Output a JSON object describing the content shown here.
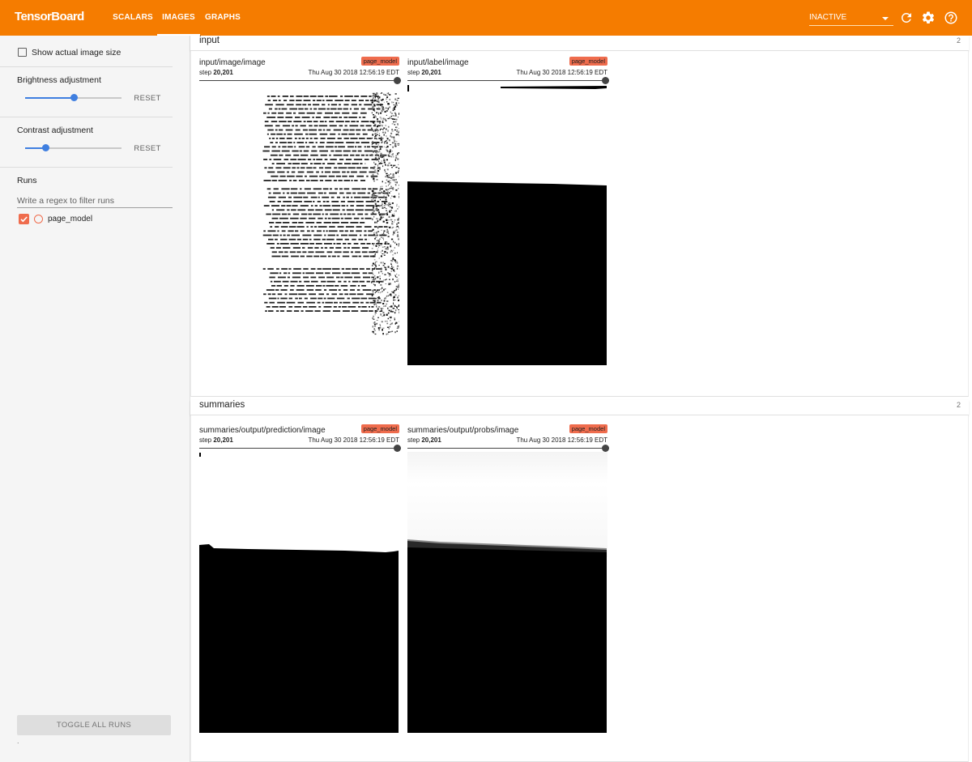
{
  "app": {
    "title": "TensorBoard",
    "tabs": [
      {
        "label": "SCALARS",
        "active": false
      },
      {
        "label": "IMAGES",
        "active": true
      },
      {
        "label": "GRAPHS",
        "active": false
      }
    ],
    "status_select": "INACTIVE",
    "icons": [
      "refresh-icon",
      "settings-icon",
      "help-icon"
    ],
    "accent_color": "#f57c00"
  },
  "sidebar": {
    "show_actual_size": {
      "label": "Show actual image size",
      "checked": false
    },
    "brightness": {
      "title": "Brightness adjustment",
      "reset": "RESET",
      "value_fraction": 0.5
    },
    "contrast": {
      "title": "Contrast adjustment",
      "reset": "RESET",
      "value_fraction": 0.2
    },
    "runs": {
      "title": "Runs",
      "filter_placeholder": "Write a regex to filter runs",
      "items": [
        {
          "name": "page_model",
          "checked": true,
          "color": "#ef6c4d"
        }
      ]
    },
    "toggle_all": "TOGGLE ALL RUNS",
    "footer_dot": "."
  },
  "categories": [
    {
      "name": "input",
      "count": "2",
      "cards": [
        {
          "tag": "input/image/image",
          "run": "page_model",
          "step_label": "step",
          "step": "20,201",
          "time": "Thu Aug 30 2018 12:56:19 EDT",
          "image": "document-scan"
        },
        {
          "tag": "input/label/image",
          "run": "page_model",
          "step_label": "step",
          "step": "20,201",
          "time": "Thu Aug 30 2018 12:56:19 EDT",
          "image": "label-mask"
        }
      ]
    },
    {
      "name": "summaries",
      "count": "2",
      "cards": [
        {
          "tag": "summaries/output/prediction/image",
          "run": "page_model",
          "step_label": "step",
          "step": "20,201",
          "time": "Thu Aug 30 2018 12:56:19 EDT",
          "image": "prediction-mask"
        },
        {
          "tag": "summaries/output/probs/image",
          "run": "page_model",
          "step_label": "step",
          "step": "20,201",
          "time": "Thu Aug 30 2018 12:56:19 EDT",
          "image": "probs-mask"
        }
      ]
    }
  ]
}
